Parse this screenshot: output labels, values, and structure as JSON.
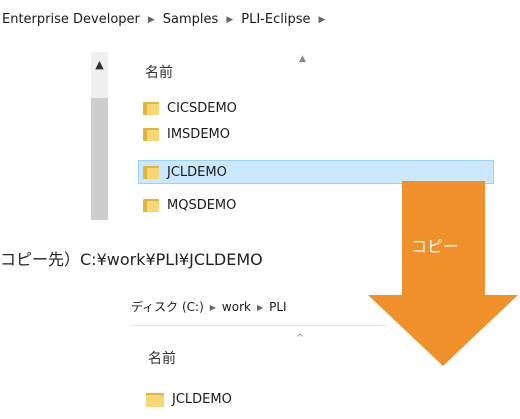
{
  "top_explorer": {
    "breadcrumb": [
      "Enterprise Developer",
      "Samples",
      "PLI-Eclipse"
    ],
    "column_header": "名前",
    "folders": [
      {
        "name": "CICSDEMO",
        "selected": false
      },
      {
        "name": "IMSDEMO",
        "selected": false
      },
      {
        "name": "JCLDEMO",
        "selected": true
      },
      {
        "name": "MQSDEMO",
        "selected": false
      }
    ]
  },
  "caption": "コピー先）C:¥work¥PLI¥JCLDEMO",
  "arrow": {
    "label": "コピー",
    "color": "#f0902a"
  },
  "bottom_explorer": {
    "breadcrumb": [
      "ディスク (C:)",
      "work",
      "PLI"
    ],
    "column_header": "名前",
    "folders": [
      {
        "name": "JCLDEMO"
      }
    ]
  },
  "colors": {
    "selection": "#cce8ff",
    "selection_border": "#99d1ff",
    "folder": "#f8d775",
    "folder_back": "#e3b43b"
  }
}
